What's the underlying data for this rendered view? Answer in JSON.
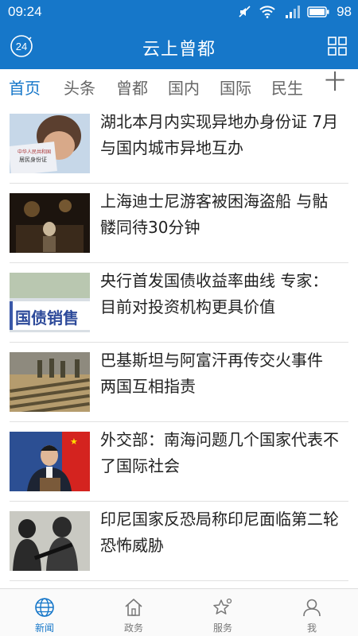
{
  "status_bar": {
    "time": "09:24",
    "battery": "98"
  },
  "app_bar": {
    "title": "云上曾都",
    "logo_text": "24"
  },
  "tabs": [
    {
      "label": "首页",
      "active": true
    },
    {
      "label": "头条",
      "active": false
    },
    {
      "label": "曾都",
      "active": false
    },
    {
      "label": "国内",
      "active": false
    },
    {
      "label": "国际",
      "active": false
    },
    {
      "label": "民生",
      "active": false
    }
  ],
  "tabs_more": "十",
  "news": [
    {
      "headline": "湖北本月内实现异地办身份证 7月与国内城市异地互办",
      "thumb_text": [
        "中华人民共和国",
        "居民身份证"
      ]
    },
    {
      "headline": "上海迪士尼游客被困海盗船 与骷髅同待30分钟"
    },
    {
      "headline": "央行首发国债收益率曲线 专家：目前对投资机构更具价值",
      "thumb_text": [
        "国债销售"
      ]
    },
    {
      "headline": "巴基斯坦与阿富汗再传交火事件 两国互相指责"
    },
    {
      "headline": "外交部：南海问题几个国家代表不了国际社会"
    },
    {
      "headline": "印尼国家反恐局称印尼面临第二轮恐怖威胁"
    }
  ],
  "bottom_nav": [
    {
      "label": "新闻",
      "icon": "globe-icon",
      "active": true
    },
    {
      "label": "政务",
      "icon": "home-icon",
      "active": false
    },
    {
      "label": "服务",
      "icon": "star-icon",
      "active": false
    },
    {
      "label": "我",
      "icon": "person-icon",
      "active": false
    }
  ],
  "colors": {
    "brand": "#1677c9",
    "text": "#222222",
    "inactive": "#666666"
  }
}
